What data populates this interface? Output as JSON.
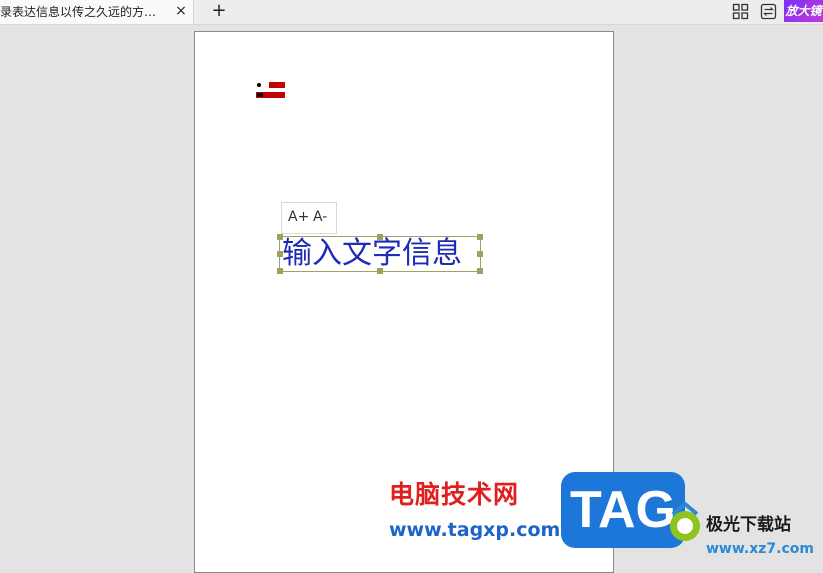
{
  "tab": {
    "title": "录表达信息以传之久远的方…",
    "close_label": "×",
    "new_tab_label": "+"
  },
  "toolbar": {
    "grid_icon": "grid-icon",
    "switch_icon": "switch-icon",
    "promo_label": "放大镜"
  },
  "document": {
    "font_increase_label": "A+",
    "font_decrease_label": "A-",
    "text_box_text": "输入文字信息",
    "text_color": "#1e2bb8",
    "selection_color": "#a0a060"
  },
  "watermark": {
    "site_name": "电脑技术网",
    "site_url": "www.tagxp.com",
    "tag_logo": "TAG",
    "xz7_name": "极光下载站",
    "xz7_url": "www.xz7.com"
  }
}
